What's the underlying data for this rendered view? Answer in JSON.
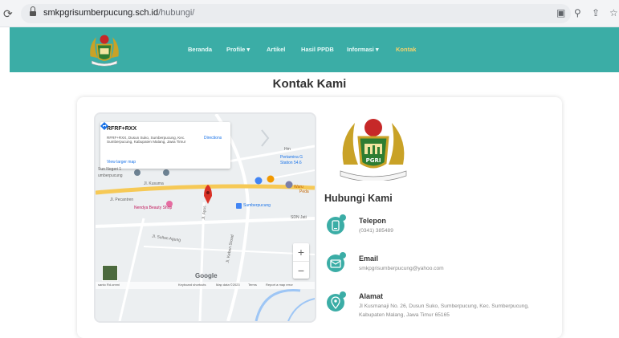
{
  "browser": {
    "url_host": "smkpgrisumberpucung.sch.id",
    "url_path": "/hubungi/"
  },
  "nav": {
    "items": [
      "Beranda",
      "Profile ▾",
      "Artikel",
      "Hasil PPDB",
      "Informasi ▾",
      "Kontak"
    ],
    "active_index": 5
  },
  "page": {
    "title": "Kontak Kami"
  },
  "map": {
    "place_title": "RFRF+RXX",
    "place_address": "RFRF+RXX, Dusun Suko, Sumberpucung, Kec. Sumberpucung, Kabupaten Malang, Jawa Timur",
    "directions_label": "Directions",
    "view_larger": "View larger map",
    "labels": {
      "pertamina": "Pertamina G",
      "station": "Station 54.6",
      "warung": "Waru",
      "peda": "Peda",
      "nendya": "Nendya Beauty Shop",
      "sumberpucung": "Sumberpucung",
      "sdn": "SDN Jati",
      "hm": "Hm",
      "sun_negeri": "Sun Negeri 1",
      "umberpucung": "umberpucung",
      "kusuma": "Jl. Kusuma",
      "pecantren": "Jl. Pecantren",
      "sultan": "Jl. Sultan Agung",
      "kebon": "Jl. Kebon Sroad",
      "agus": "Jl. Ayus"
    },
    "zoom_in": "+",
    "zoom_out": "−",
    "google_logo": "Google",
    "footer": {
      "shortcuts": "Keyboard shortcuts",
      "data": "Map data ©2023",
      "terms": "Terms",
      "report": "Report a map error",
      "left": "santo Rd.ommi"
    }
  },
  "contact": {
    "title": "Hubungi Kami",
    "items": [
      {
        "label": "Telepon",
        "value": "(0341) 385489",
        "icon": "phone-icon"
      },
      {
        "label": "Email",
        "value": "smkpgrisumberpucung@yahoo.com",
        "icon": "email-icon"
      },
      {
        "label": "Alamat",
        "value": "Jl Kusmanaji No. 26, Dusun Suko, Sumberpucung, Kec. Sumberpucung, Kabupaten Malang, Jawa Timur 65165",
        "icon": "location-icon"
      }
    ]
  },
  "logo_text": "PGRI",
  "colors": {
    "nav_bg": "#3bada6",
    "nav_active": "#f6d36b",
    "icon_teal": "#3bada6"
  }
}
